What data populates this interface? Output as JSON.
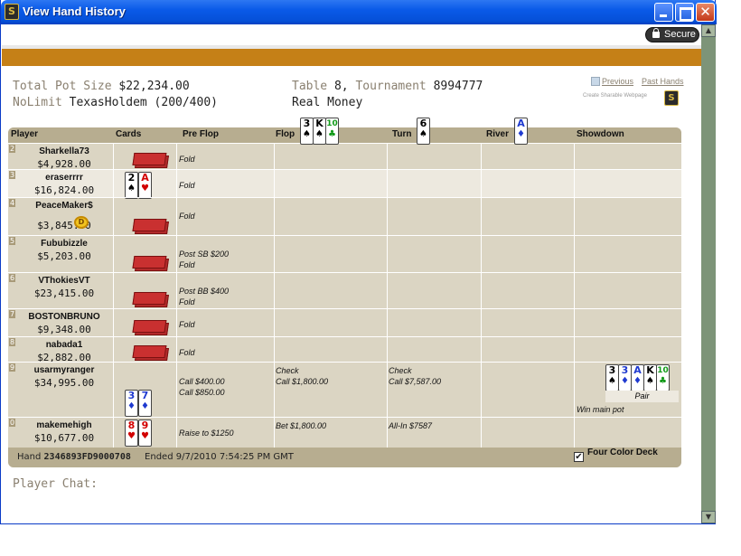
{
  "window": {
    "title": "View Hand History"
  },
  "toolbar": {
    "secure_label": "Secure"
  },
  "summary": {
    "total_pot_label": "Total Pot Size",
    "total_pot": "$22,234.00",
    "game_prefix": "NoLimit",
    "game": "TexasHoldem (200/400)",
    "table_label": "Table",
    "table_num": "8,",
    "tournament_label": "Tournament",
    "tournament_num": "8994777",
    "money": "Real Money"
  },
  "links": {
    "previous": "Previous",
    "past_hands": "Past Hands",
    "share": "Create Sharable Webpage"
  },
  "board": {
    "flop": [
      {
        "rank": "3",
        "suit": "♠",
        "color": "blk"
      },
      {
        "rank": "K",
        "suit": "♠",
        "color": "blk"
      },
      {
        "rank": "10",
        "suit": "♣",
        "color": "grn"
      }
    ],
    "turn": [
      {
        "rank": "6",
        "suit": "♠",
        "color": "blk"
      }
    ],
    "river": [
      {
        "rank": "A",
        "suit": "♦",
        "color": "blu"
      }
    ]
  },
  "columns": {
    "player": "Player",
    "cards": "Cards",
    "preflop": "Pre Flop",
    "flop": "Flop",
    "turn": "Turn",
    "river": "River",
    "showdown": "Showdown"
  },
  "players": [
    {
      "seat": "2",
      "name": "Sharkella73",
      "stack": "$4,928.00",
      "preflop": "Fold",
      "flop": "",
      "turn": ""
    },
    {
      "seat": "3",
      "name": "eraserrrr",
      "stack": "$16,824.00",
      "preflop": "Fold",
      "flop": "",
      "turn": ""
    },
    {
      "seat": "4",
      "name": "PeaceMaker$",
      "stack": "$3,845.00",
      "preflop": "Fold",
      "flop": "",
      "turn": ""
    },
    {
      "seat": "5",
      "name": "Fububizzle",
      "stack": "$5,203.00",
      "preflop": "Post SB $200",
      "preflop2": "Fold",
      "flop": "",
      "turn": ""
    },
    {
      "seat": "6",
      "name": "VThokiesVT",
      "stack": "$23,415.00",
      "preflop": "Post BB $400",
      "preflop2": "Fold",
      "flop": "",
      "turn": ""
    },
    {
      "seat": "7",
      "name": "BOSTONBRUNO",
      "stack": "$9,348.00",
      "preflop": "Fold",
      "flop": "",
      "turn": ""
    },
    {
      "seat": "8",
      "name": "nabada1",
      "stack": "$2,882.00",
      "preflop": "Fold",
      "flop": "",
      "turn": ""
    },
    {
      "seat": "9",
      "name": "usarmyranger",
      "stack": "$34,995.00",
      "preflop": "Call $400.00",
      "preflop2": "Call $850.00",
      "flop": "Check",
      "flop2": "Call $1,800.00",
      "turn": "Check",
      "turn2": "Call $7,587.00",
      "showdown": "Win main pot",
      "hand_label": "Pair"
    },
    {
      "seat": "0",
      "name": "makemehigh",
      "stack": "$10,677.00",
      "preflop": "Raise to $1250",
      "flop": "Bet $1,800.00",
      "turn": "All-In $7587"
    }
  ],
  "hole_cards": {
    "eraserrrr": [
      {
        "rank": "2",
        "suit": "♠",
        "color": "blk"
      },
      {
        "rank": "A",
        "suit": "♥",
        "color": "red"
      }
    ],
    "usarmyranger": [
      {
        "rank": "3",
        "suit": "♦",
        "color": "blu"
      },
      {
        "rank": "7",
        "suit": "♦",
        "color": "blu"
      }
    ],
    "makemehigh": [
      {
        "rank": "8",
        "suit": "♥",
        "color": "red"
      },
      {
        "rank": "9",
        "suit": "♥",
        "color": "red"
      }
    ]
  },
  "showdown_cards": [
    {
      "rank": "3",
      "suit": "♠",
      "color": "blk"
    },
    {
      "rank": "3",
      "suit": "♦",
      "color": "blu"
    },
    {
      "rank": "A",
      "suit": "♦",
      "color": "blu"
    },
    {
      "rank": "K",
      "suit": "♠",
      "color": "blk"
    },
    {
      "rank": "10",
      "suit": "♣",
      "color": "grn"
    }
  ],
  "dealer_chip": "D",
  "footer": {
    "hand_label": "Hand",
    "hand_id": "2346893FD9000708",
    "ended": "Ended 9/7/2010 7:54:25 PM GMT",
    "four_color": "Four Color Deck"
  },
  "chat": {
    "label": "Player Chat:"
  },
  "colors": {
    "accent_bar": "#c58017",
    "table_bg": "#dbd5c3",
    "header_bg": "#b7ad90"
  }
}
